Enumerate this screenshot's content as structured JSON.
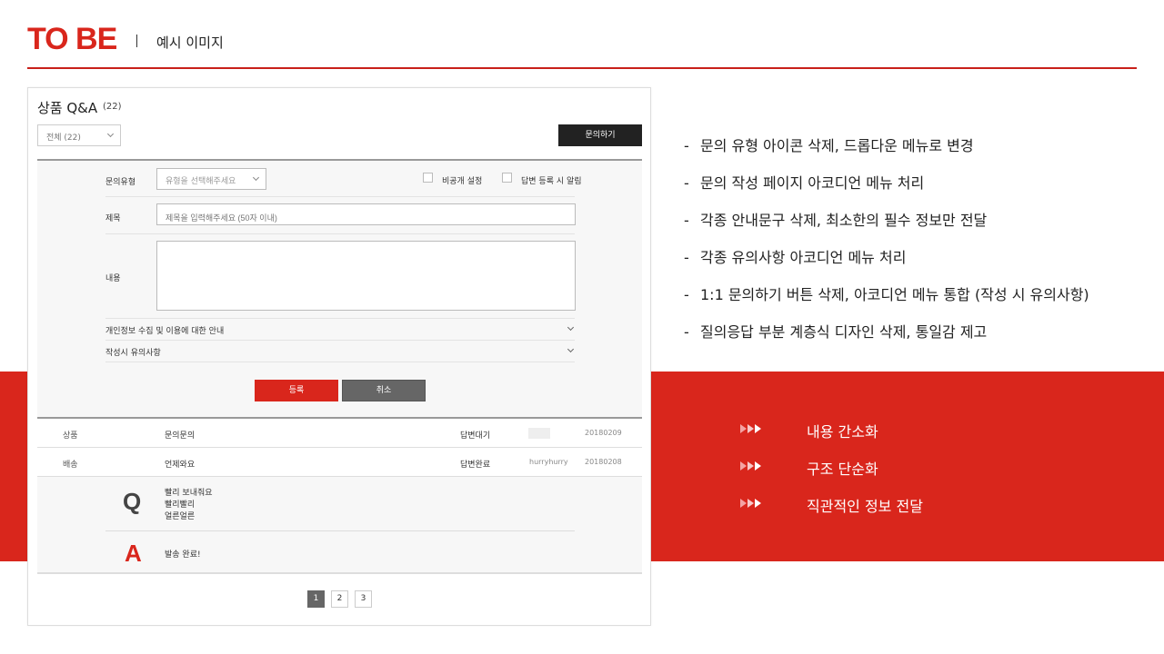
{
  "header": {
    "title": "TO BE",
    "subtitle": "예시 이미지"
  },
  "mockup": {
    "title": "상품 Q&A",
    "count": "(22)",
    "filter_value": "전체 (22)",
    "ask_button": "문의하기",
    "form": {
      "type_label": "문의유형",
      "type_placeholder": "유형을 선택해주세요",
      "private_label": "비공개 설정",
      "notify_label": "답변 등록 시 알림",
      "title_label": "제목",
      "title_placeholder": "제목을 입력해주세요 (50자 이내)",
      "content_label": "내용",
      "privacy_accordion": "개인정보 수집 및 이용에 대한 안내",
      "notice_accordion": "작성시 유의사항",
      "register_button": "등록",
      "cancel_button": "취소"
    },
    "rows": [
      {
        "category": "상품",
        "title": "문의문의",
        "status": "답변대기",
        "user": "",
        "date": "20180209"
      },
      {
        "category": "배송",
        "title": "언제와요",
        "status": "답변완료",
        "user": "hurryhurry",
        "date": "20180208"
      }
    ],
    "answer": {
      "q_letter": "Q",
      "q_lines": [
        "빨리 보내줘요",
        "빨리빨리",
        "얼른얼른"
      ],
      "a_letter": "A",
      "a_text": "발송 완료!"
    },
    "pages": [
      "1",
      "2",
      "3"
    ],
    "active_page": "1"
  },
  "bullets": [
    "문의 유형 아이콘 삭제, 드롭다운 메뉴로 변경",
    "문의 작성 페이지 아코디언 메뉴 처리",
    "각종 안내문구 삭제, 최소한의 필수 정보만 전달",
    "각종 유의사항 아코디언 메뉴 처리",
    "1:1 문의하기 버튼 삭제, 아코디언 메뉴 통합 (작성 시 유의사항)",
    "질의응답 부분 계층식 디자인 삭제, 통일감 제고"
  ],
  "highlights": [
    "내용 간소화",
    "구조 단순화",
    "직관적인 정보 전달"
  ],
  "colors": {
    "accent": "#d9261c",
    "dark_button": "#222222",
    "cancel_button": "#666666"
  }
}
